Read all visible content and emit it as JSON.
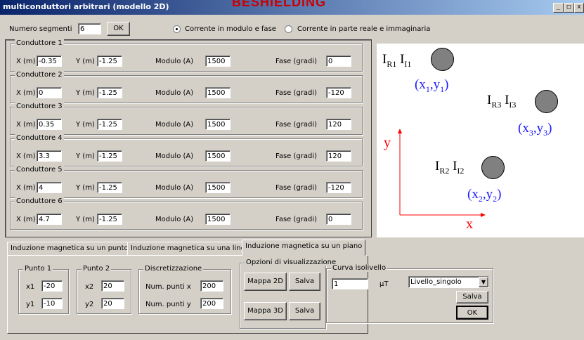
{
  "window": {
    "title": "multiconduttori arbitrari (modello 2D)",
    "background_text": "BESHIELDING",
    "buttons": [
      "_",
      "□",
      "x"
    ]
  },
  "segments": {
    "label": "Numero segmenti",
    "value": "6",
    "ok_label": "OK"
  },
  "mode": {
    "option1": "Corrente in modulo e fase",
    "option2": "Corrente in parte reale e immaginaria",
    "selected": "option1"
  },
  "field_labels": {
    "x": "X (m)",
    "y": "Y (m)",
    "modulo": "Modulo (A)",
    "fase": "Fase (gradi)"
  },
  "conductors": [
    {
      "title": "Conduttore 1",
      "x": "-0.35",
      "y": "-1.25",
      "modulo": "1500",
      "fase": "0"
    },
    {
      "title": "Conduttore 2",
      "x": "0",
      "y": "-1.25",
      "modulo": "1500",
      "fase": "-120"
    },
    {
      "title": "Conduttore 3",
      "x": "0.35",
      "y": "-1.25",
      "modulo": "1500",
      "fase": "120"
    },
    {
      "title": "Conduttore 4",
      "x": "3.3",
      "y": "-1.25",
      "modulo": "1500",
      "fase": "120"
    },
    {
      "title": "Conduttore 5",
      "x": "4",
      "y": "-1.25",
      "modulo": "1500",
      "fase": "-120"
    },
    {
      "title": "Conduttore 6",
      "x": "4.7",
      "y": "-1.25",
      "modulo": "1500",
      "fase": "0"
    }
  ],
  "diagram": {
    "c1": {
      "re": "R1",
      "im": "I1",
      "x": "1",
      "y": "1"
    },
    "c3": {
      "re": "R3",
      "im": "I3",
      "x": "3",
      "y": "3"
    },
    "c2": {
      "re": "R2",
      "im": "I2",
      "x": "2",
      "y": "2"
    },
    "axis_x": "x",
    "axis_y": "y",
    "letter_I": "I",
    "letter_x": "x",
    "letter_y": "y",
    "colors": {
      "axis": "#ff0000",
      "coords": "#1a1aff",
      "circle": "#808080"
    }
  },
  "tabs": [
    {
      "label": "Induzione magnetica su un punto",
      "active": false
    },
    {
      "label": "Induzione magnetica su una linea",
      "active": false
    },
    {
      "label": "Induzione magnetica su un piano",
      "active": true
    }
  ],
  "piano": {
    "punto1": {
      "title": "Punto 1",
      "x_label": "x1",
      "x": "-20",
      "y_label": "y1",
      "y": "-10"
    },
    "punto2": {
      "title": "Punto 2",
      "x_label": "x2",
      "x": "20",
      "y_label": "y2",
      "y": "20"
    },
    "discretizzazione": {
      "title": "Discretizzazione",
      "x_label": "Num. punti x",
      "x": "200",
      "y_label": "Num. punti y",
      "y": "200"
    },
    "opzioni": {
      "title": "Opzioni di visualizzazione",
      "mappa2d": "Mappa 2D",
      "mappa3d": "Mappa 3D",
      "salva": "Salva"
    },
    "curva": {
      "title": "Curva isolivello",
      "value": "1",
      "unit": "µT",
      "select": "Livello_singolo",
      "salva": "Salva",
      "ok": "OK"
    }
  }
}
